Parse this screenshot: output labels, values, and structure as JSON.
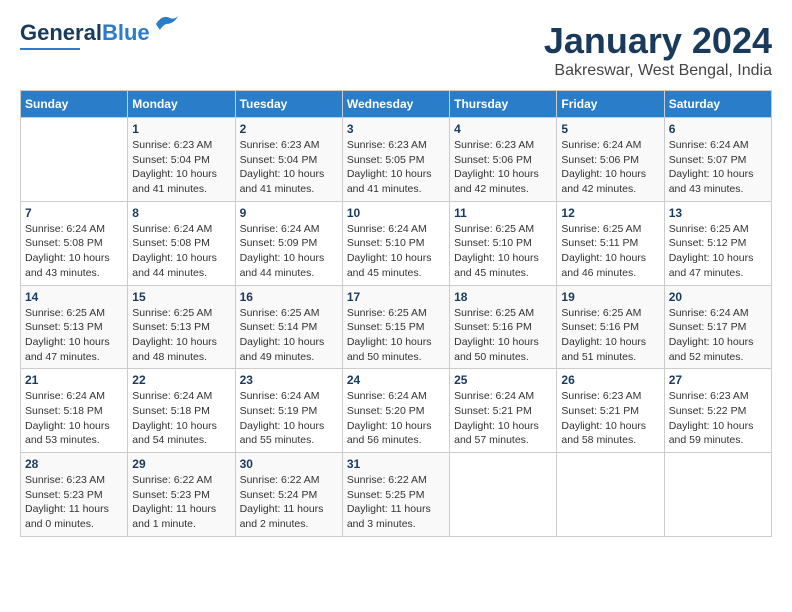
{
  "header": {
    "logo_general": "General",
    "logo_blue": "Blue",
    "month_title": "January 2024",
    "location": "Bakreswar, West Bengal, India"
  },
  "weekdays": [
    "Sunday",
    "Monday",
    "Tuesday",
    "Wednesday",
    "Thursday",
    "Friday",
    "Saturday"
  ],
  "weeks": [
    [
      {
        "day": "",
        "sunrise": "",
        "sunset": "",
        "daylight": ""
      },
      {
        "day": "1",
        "sunrise": "Sunrise: 6:23 AM",
        "sunset": "Sunset: 5:04 PM",
        "daylight": "Daylight: 10 hours and 41 minutes."
      },
      {
        "day": "2",
        "sunrise": "Sunrise: 6:23 AM",
        "sunset": "Sunset: 5:04 PM",
        "daylight": "Daylight: 10 hours and 41 minutes."
      },
      {
        "day": "3",
        "sunrise": "Sunrise: 6:23 AM",
        "sunset": "Sunset: 5:05 PM",
        "daylight": "Daylight: 10 hours and 41 minutes."
      },
      {
        "day": "4",
        "sunrise": "Sunrise: 6:23 AM",
        "sunset": "Sunset: 5:06 PM",
        "daylight": "Daylight: 10 hours and 42 minutes."
      },
      {
        "day": "5",
        "sunrise": "Sunrise: 6:24 AM",
        "sunset": "Sunset: 5:06 PM",
        "daylight": "Daylight: 10 hours and 42 minutes."
      },
      {
        "day": "6",
        "sunrise": "Sunrise: 6:24 AM",
        "sunset": "Sunset: 5:07 PM",
        "daylight": "Daylight: 10 hours and 43 minutes."
      }
    ],
    [
      {
        "day": "7",
        "sunrise": "Sunrise: 6:24 AM",
        "sunset": "Sunset: 5:08 PM",
        "daylight": "Daylight: 10 hours and 43 minutes."
      },
      {
        "day": "8",
        "sunrise": "Sunrise: 6:24 AM",
        "sunset": "Sunset: 5:08 PM",
        "daylight": "Daylight: 10 hours and 44 minutes."
      },
      {
        "day": "9",
        "sunrise": "Sunrise: 6:24 AM",
        "sunset": "Sunset: 5:09 PM",
        "daylight": "Daylight: 10 hours and 44 minutes."
      },
      {
        "day": "10",
        "sunrise": "Sunrise: 6:24 AM",
        "sunset": "Sunset: 5:10 PM",
        "daylight": "Daylight: 10 hours and 45 minutes."
      },
      {
        "day": "11",
        "sunrise": "Sunrise: 6:25 AM",
        "sunset": "Sunset: 5:10 PM",
        "daylight": "Daylight: 10 hours and 45 minutes."
      },
      {
        "day": "12",
        "sunrise": "Sunrise: 6:25 AM",
        "sunset": "Sunset: 5:11 PM",
        "daylight": "Daylight: 10 hours and 46 minutes."
      },
      {
        "day": "13",
        "sunrise": "Sunrise: 6:25 AM",
        "sunset": "Sunset: 5:12 PM",
        "daylight": "Daylight: 10 hours and 47 minutes."
      }
    ],
    [
      {
        "day": "14",
        "sunrise": "Sunrise: 6:25 AM",
        "sunset": "Sunset: 5:13 PM",
        "daylight": "Daylight: 10 hours and 47 minutes."
      },
      {
        "day": "15",
        "sunrise": "Sunrise: 6:25 AM",
        "sunset": "Sunset: 5:13 PM",
        "daylight": "Daylight: 10 hours and 48 minutes."
      },
      {
        "day": "16",
        "sunrise": "Sunrise: 6:25 AM",
        "sunset": "Sunset: 5:14 PM",
        "daylight": "Daylight: 10 hours and 49 minutes."
      },
      {
        "day": "17",
        "sunrise": "Sunrise: 6:25 AM",
        "sunset": "Sunset: 5:15 PM",
        "daylight": "Daylight: 10 hours and 50 minutes."
      },
      {
        "day": "18",
        "sunrise": "Sunrise: 6:25 AM",
        "sunset": "Sunset: 5:16 PM",
        "daylight": "Daylight: 10 hours and 50 minutes."
      },
      {
        "day": "19",
        "sunrise": "Sunrise: 6:25 AM",
        "sunset": "Sunset: 5:16 PM",
        "daylight": "Daylight: 10 hours and 51 minutes."
      },
      {
        "day": "20",
        "sunrise": "Sunrise: 6:24 AM",
        "sunset": "Sunset: 5:17 PM",
        "daylight": "Daylight: 10 hours and 52 minutes."
      }
    ],
    [
      {
        "day": "21",
        "sunrise": "Sunrise: 6:24 AM",
        "sunset": "Sunset: 5:18 PM",
        "daylight": "Daylight: 10 hours and 53 minutes."
      },
      {
        "day": "22",
        "sunrise": "Sunrise: 6:24 AM",
        "sunset": "Sunset: 5:18 PM",
        "daylight": "Daylight: 10 hours and 54 minutes."
      },
      {
        "day": "23",
        "sunrise": "Sunrise: 6:24 AM",
        "sunset": "Sunset: 5:19 PM",
        "daylight": "Daylight: 10 hours and 55 minutes."
      },
      {
        "day": "24",
        "sunrise": "Sunrise: 6:24 AM",
        "sunset": "Sunset: 5:20 PM",
        "daylight": "Daylight: 10 hours and 56 minutes."
      },
      {
        "day": "25",
        "sunrise": "Sunrise: 6:24 AM",
        "sunset": "Sunset: 5:21 PM",
        "daylight": "Daylight: 10 hours and 57 minutes."
      },
      {
        "day": "26",
        "sunrise": "Sunrise: 6:23 AM",
        "sunset": "Sunset: 5:21 PM",
        "daylight": "Daylight: 10 hours and 58 minutes."
      },
      {
        "day": "27",
        "sunrise": "Sunrise: 6:23 AM",
        "sunset": "Sunset: 5:22 PM",
        "daylight": "Daylight: 10 hours and 59 minutes."
      }
    ],
    [
      {
        "day": "28",
        "sunrise": "Sunrise: 6:23 AM",
        "sunset": "Sunset: 5:23 PM",
        "daylight": "Daylight: 11 hours and 0 minutes."
      },
      {
        "day": "29",
        "sunrise": "Sunrise: 6:22 AM",
        "sunset": "Sunset: 5:23 PM",
        "daylight": "Daylight: 11 hours and 1 minute."
      },
      {
        "day": "30",
        "sunrise": "Sunrise: 6:22 AM",
        "sunset": "Sunset: 5:24 PM",
        "daylight": "Daylight: 11 hours and 2 minutes."
      },
      {
        "day": "31",
        "sunrise": "Sunrise: 6:22 AM",
        "sunset": "Sunset: 5:25 PM",
        "daylight": "Daylight: 11 hours and 3 minutes."
      },
      {
        "day": "",
        "sunrise": "",
        "sunset": "",
        "daylight": ""
      },
      {
        "day": "",
        "sunrise": "",
        "sunset": "",
        "daylight": ""
      },
      {
        "day": "",
        "sunrise": "",
        "sunset": "",
        "daylight": ""
      }
    ]
  ]
}
